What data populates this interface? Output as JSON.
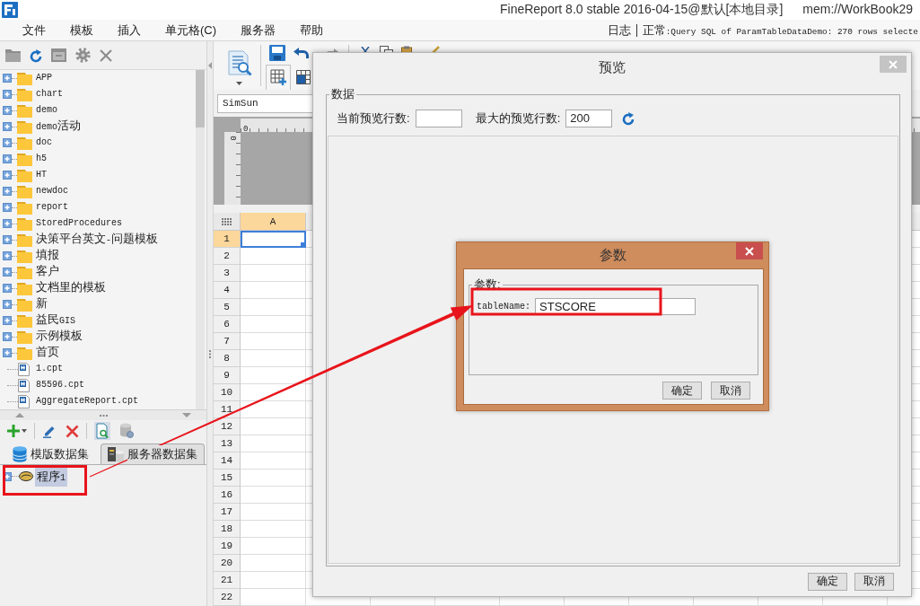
{
  "window": {
    "title": "FineReport 8.0 stable 2016-04-15@默认[本地目录]",
    "document": "mem://WorkBook29"
  },
  "menu": [
    "文件",
    "模板",
    "插入",
    "单元格(C)",
    "服务器",
    "帮助"
  ],
  "status": {
    "log": "日志",
    "message": "正常:Query SQL of ParamTableDataDemo: 270 rows selecte"
  },
  "file_tree": {
    "items": [
      {
        "kind": "folder",
        "name": "APP",
        "expanded": false
      },
      {
        "kind": "folder",
        "name": "chart",
        "expanded": false
      },
      {
        "kind": "folder",
        "name": "demo",
        "expanded": false
      },
      {
        "kind": "folder",
        "name": "demo活动",
        "expanded": false
      },
      {
        "kind": "folder",
        "name": "doc",
        "expanded": false
      },
      {
        "kind": "folder",
        "name": "h5",
        "expanded": false
      },
      {
        "kind": "folder",
        "name": "HT",
        "expanded": false
      },
      {
        "kind": "folder",
        "name": "newdoc",
        "expanded": false
      },
      {
        "kind": "folder",
        "name": "report",
        "expanded": false
      },
      {
        "kind": "folder",
        "name": "StoredProcedures",
        "expanded": false
      },
      {
        "kind": "folder",
        "name": "决策平台英文-问题模板",
        "expanded": false
      },
      {
        "kind": "folder",
        "name": "填报",
        "expanded": false
      },
      {
        "kind": "folder",
        "name": "客户",
        "expanded": false
      },
      {
        "kind": "folder",
        "name": "文档里的模板",
        "expanded": false
      },
      {
        "kind": "folder",
        "name": "新",
        "expanded": false
      },
      {
        "kind": "folder",
        "name": "益民GIS",
        "expanded": false
      },
      {
        "kind": "folder",
        "name": "示例模板",
        "expanded": false
      },
      {
        "kind": "folder",
        "name": "首页",
        "expanded": false
      },
      {
        "kind": "file",
        "name": "1.cpt"
      },
      {
        "kind": "file",
        "name": "85596.cpt"
      },
      {
        "kind": "file",
        "name": "AggregateReport.cpt"
      }
    ]
  },
  "datasets": {
    "tabs": [
      {
        "label": "模版数据集",
        "kind": "template",
        "selected": true
      },
      {
        "label": "服务器数据集",
        "kind": "server",
        "selected": false
      }
    ],
    "items": [
      {
        "name": "程序1",
        "expanded": false,
        "selected": true
      }
    ]
  },
  "toolbar": {
    "font": "SimSun"
  },
  "ruler": {
    "top_label": "0",
    "side_label": "0"
  },
  "sheet": {
    "columns": [
      {
        "label": "A",
        "selected": true
      }
    ],
    "rows": [
      {
        "label": "1",
        "selected": true
      },
      {
        "label": "2",
        "selected": false
      },
      {
        "label": "3",
        "selected": false
      },
      {
        "label": "4",
        "selected": false
      },
      {
        "label": "5",
        "selected": false
      },
      {
        "label": "6",
        "selected": false
      },
      {
        "label": "7",
        "selected": false
      },
      {
        "label": "8",
        "selected": false
      },
      {
        "label": "9",
        "selected": false
      },
      {
        "label": "10",
        "selected": false
      },
      {
        "label": "11",
        "selected": false
      },
      {
        "label": "12",
        "selected": false
      },
      {
        "label": "13",
        "selected": false
      },
      {
        "label": "14",
        "selected": false
      },
      {
        "label": "15",
        "selected": false
      },
      {
        "label": "16",
        "selected": false
      },
      {
        "label": "17",
        "selected": false
      },
      {
        "label": "18",
        "selected": false
      },
      {
        "label": "19",
        "selected": false
      },
      {
        "label": "20",
        "selected": false
      },
      {
        "label": "21",
        "selected": false
      },
      {
        "label": "22",
        "selected": false
      }
    ]
  },
  "preview_dialog": {
    "title": "预览",
    "group": "数据",
    "fields": [
      {
        "label": "当前预览行数:"
      },
      {
        "label": "最大的预览行数:",
        "value": "200"
      }
    ],
    "buttons": [
      "确定",
      "取消"
    ]
  },
  "param_dialog": {
    "title": "参数",
    "group": "参数:",
    "params": [
      {
        "name": "tableName:",
        "value": "STSCORE"
      }
    ],
    "buttons": [
      "确定",
      "取消"
    ]
  }
}
